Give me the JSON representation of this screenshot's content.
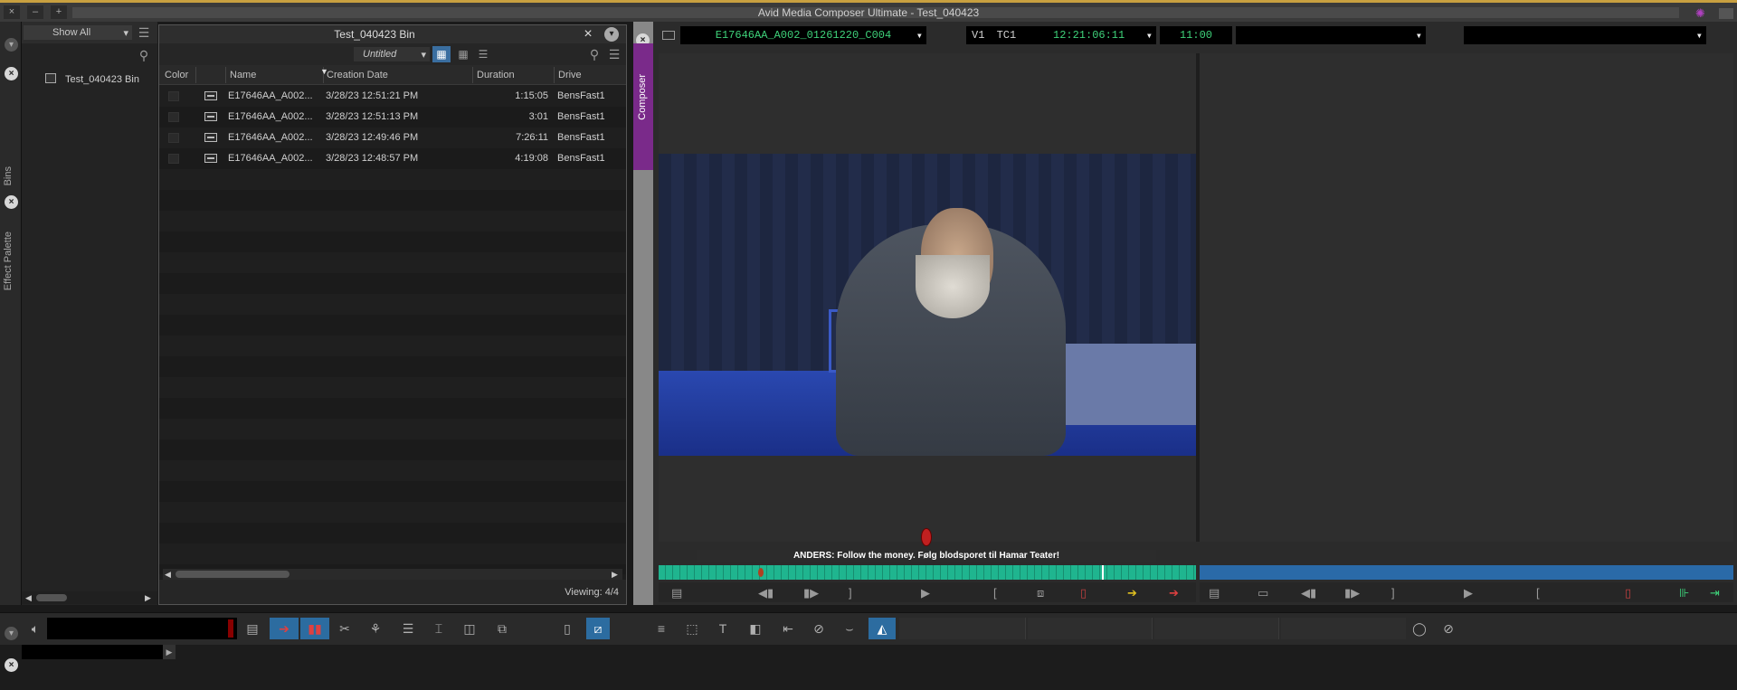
{
  "app_title": "Avid Media Composer Ultimate - Test_040423",
  "window_buttons": [
    "×",
    "–",
    "+"
  ],
  "side_tabs": {
    "bins": "Bins",
    "effect_palette": "Effect Palette"
  },
  "bins_panel": {
    "filter": "Show All",
    "items": [
      {
        "label": "Test_040423 Bin"
      }
    ]
  },
  "bin_window": {
    "title": "Test_040423 Bin",
    "view_name": "Untitled",
    "columns": [
      "Color",
      "Name",
      "Creation Date",
      "Duration",
      "Drive"
    ],
    "rows": [
      {
        "name": "E17646AA_A002...",
        "date": "3/28/23 12:51:21 PM",
        "duration": "1:15:05",
        "drive": "BensFast1"
      },
      {
        "name": "E17646AA_A002...",
        "date": "3/28/23 12:51:13 PM",
        "duration": "3:01",
        "drive": "BensFast1"
      },
      {
        "name": "E17646AA_A002...",
        "date": "3/28/23 12:49:46 PM",
        "duration": "7:26:11",
        "drive": "BensFast1"
      },
      {
        "name": "E17646AA_A002...",
        "date": "3/28/23 12:48:57 PM",
        "duration": "4:19:08",
        "drive": "BensFast1"
      }
    ],
    "footer": "Viewing: 4/4"
  },
  "composer": {
    "tab_label": "Composer",
    "clip_name": "E17646AA_A002_01261220_C004",
    "track": "V1",
    "tc_label": "TC1",
    "timecode": "12:21:06:11",
    "duration": "11:00",
    "subtitle": "ANDERS: Follow the money. Følg blodsporet til Hamar Teater!",
    "scrub_color_source": "#1fb58f",
    "scrub_color_record": "#2a6aa8",
    "playhead_fraction": 0.825
  },
  "colors": {
    "accent_purple": "#7a2a8a",
    "tc_green": "#3ed27a",
    "active_blue": "#2c6ca0"
  }
}
